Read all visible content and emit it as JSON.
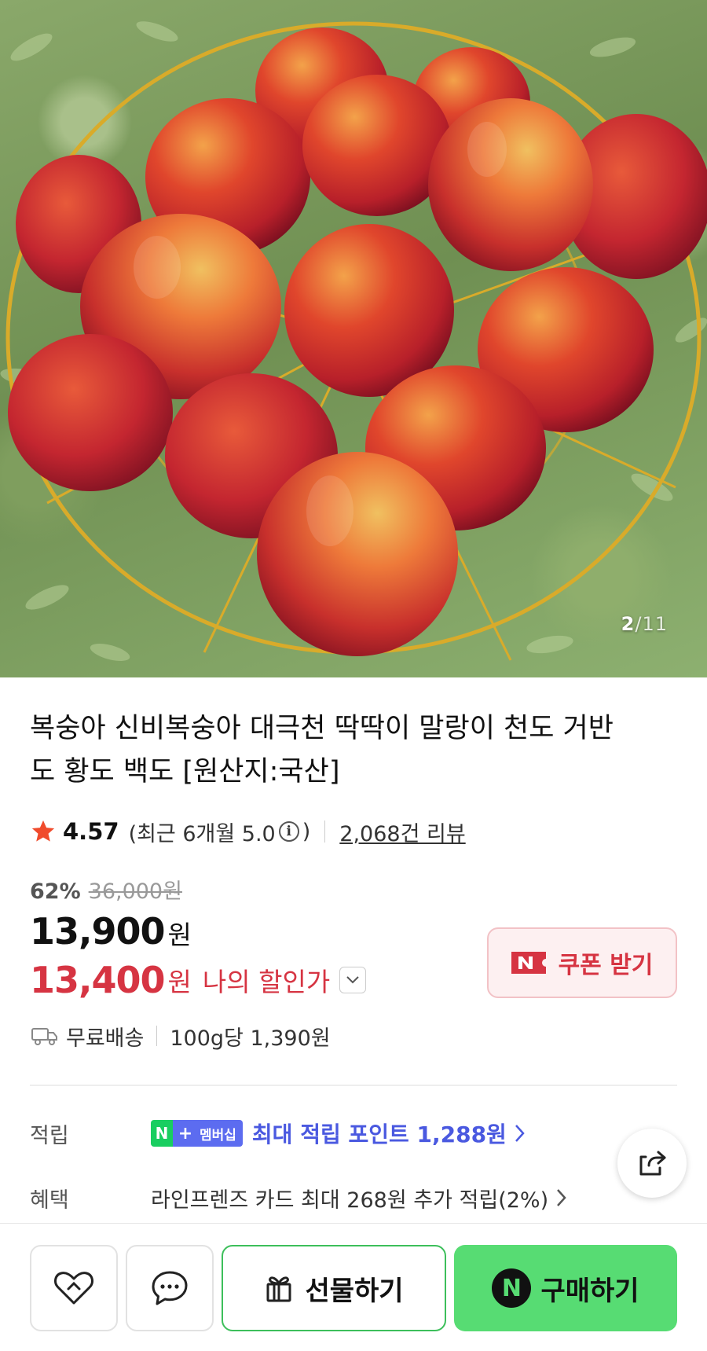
{
  "hero": {
    "image_alt": "peaches in a golden wire basket on green leaves",
    "current_page": "2",
    "separator": "/",
    "total_pages": "11"
  },
  "product": {
    "title": "복숭아 신비복숭아 대극천 딱딱이 말랑이 천도 거반도 황도 백도 [원산지:국산]",
    "rating": "4.57",
    "recent_rating_prefix": "(최근 6개월 5.0",
    "recent_rating_suffix": ")",
    "info_glyph": "i",
    "review_count": "2,068건 리뷰",
    "discount_rate": "62%",
    "original_price": "36,000원",
    "price": "13,900",
    "price_unit": "원",
    "my_price": "13,400",
    "my_price_unit": "원",
    "my_price_label": "나의 할인가",
    "coupon_label": "쿠폰 받기",
    "shipping": "무료배송",
    "unit_price": "100g당 1,390원"
  },
  "benefits": {
    "points_label": "적립",
    "membership_n": "N",
    "membership_plus": "+",
    "membership_text": "멤버십",
    "points_text": "최대 적립 포인트 1,288원",
    "benefit_label": "혜택",
    "benefit_text": "라인프렌즈 카드 최대 268원 추가 적립(2%)"
  },
  "bottom_bar": {
    "gift_label": "선물하기",
    "buy_label": "구매하기",
    "buy_n": "N"
  },
  "colors": {
    "accent_red": "#d63442",
    "naver_green": "#57dc73",
    "membership_blue": "#5c6cf0"
  },
  "icons": [
    "star-icon",
    "info-icon",
    "chevron-down-icon",
    "n-coupon-icon",
    "truck-icon",
    "chevron-right-icon",
    "share-icon",
    "heart-icon",
    "chat-icon",
    "gift-icon",
    "naver-n-icon"
  ]
}
